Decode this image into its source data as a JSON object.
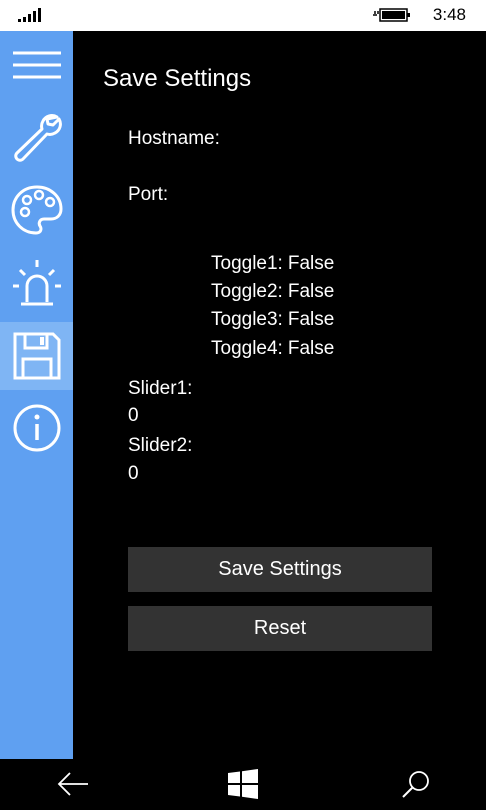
{
  "status_bar": {
    "time": "3:48",
    "icons": [
      "signal-strength-icon",
      "battery-charging-icon"
    ]
  },
  "sidebar": {
    "background": "#5fa0f1",
    "active_background": "#7fb5f4",
    "items": [
      {
        "icon": "hamburger-menu-icon"
      },
      {
        "icon": "wrench-icon"
      },
      {
        "icon": "palette-icon"
      },
      {
        "icon": "light-alarm-icon"
      },
      {
        "icon": "floppy-disk-icon",
        "active": true
      },
      {
        "icon": "info-icon"
      }
    ]
  },
  "page": {
    "title": "Save Settings",
    "hostname_label": "Hostname:",
    "port_label": "Port:",
    "toggles": [
      {
        "label": "Toggle1:",
        "value": "False"
      },
      {
        "label": "Toggle2:",
        "value": "False"
      },
      {
        "label": "Toggle3:",
        "value": "False"
      },
      {
        "label": "Toggle4:",
        "value": "False"
      }
    ],
    "slider1_label": "Slider1:",
    "slider1_value": "0",
    "slider2_label": "Slider2:",
    "slider2_value": "0",
    "save_button": "Save Settings",
    "reset_button": "Reset",
    "button_background": "#333333"
  },
  "nav_bar": {
    "icons": [
      "back-arrow-icon",
      "windows-start-icon",
      "search-icon"
    ]
  }
}
